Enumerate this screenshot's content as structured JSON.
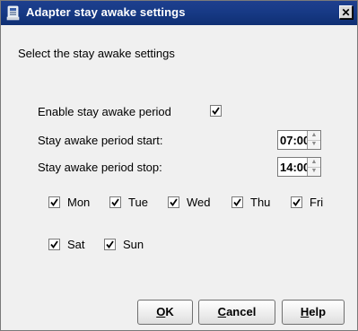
{
  "window": {
    "title": "Adapter stay awake settings",
    "close_glyph": "✕"
  },
  "heading": "Select the stay awake settings",
  "enable": {
    "label": "Enable stay awake period",
    "checked": true
  },
  "start": {
    "label": "Stay awake period start:",
    "value": "07:00"
  },
  "stop": {
    "label": "Stay awake period stop:",
    "value": "14:00"
  },
  "days": [
    {
      "label": "Mon",
      "checked": true
    },
    {
      "label": "Tue",
      "checked": true
    },
    {
      "label": "Wed",
      "checked": true
    },
    {
      "label": "Thu",
      "checked": true
    },
    {
      "label": "Fri",
      "checked": true
    },
    {
      "label": "Sat",
      "checked": true
    },
    {
      "label": "Sun",
      "checked": true
    }
  ],
  "buttons": {
    "ok": {
      "mnemonic": "O",
      "rest": "K"
    },
    "cancel": {
      "mnemonic": "C",
      "rest": "ancel"
    },
    "help": {
      "mnemonic": "H",
      "rest": "elp"
    }
  },
  "colors": {
    "titlebar": "#173a86",
    "dialog_bg": "#f0f0f0"
  }
}
